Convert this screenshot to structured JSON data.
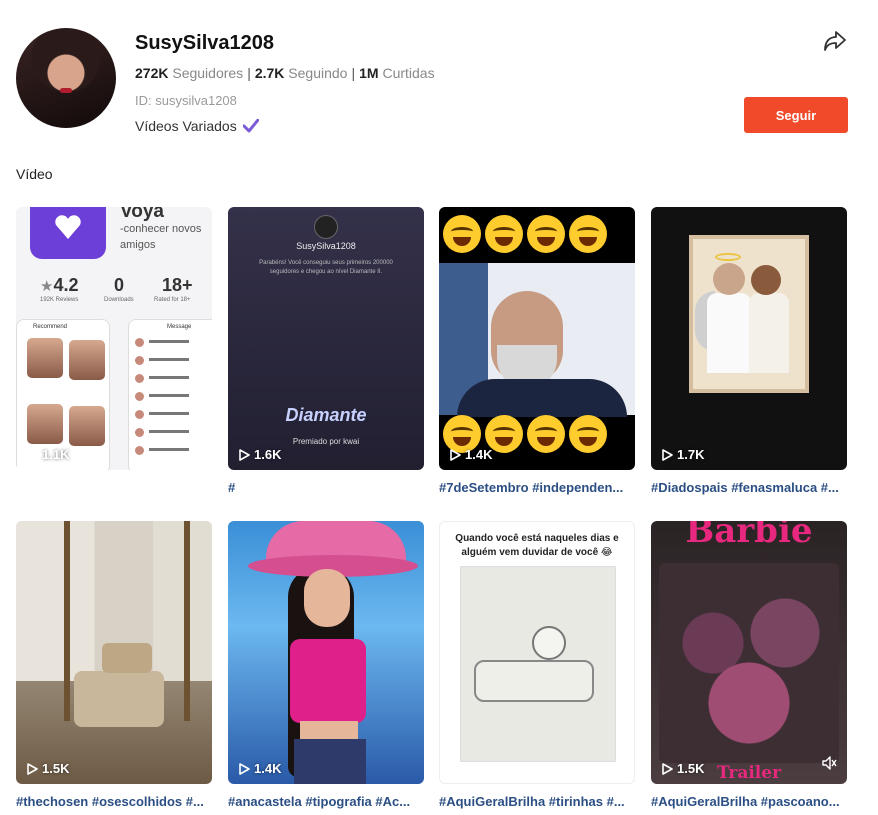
{
  "profile": {
    "name": "SusySilva1208",
    "followers_count": "272K",
    "followers_label": "Seguidores",
    "following_count": "2.7K",
    "following_label": "Seguindo",
    "likes_count": "1M",
    "likes_label": "Curtidas",
    "user_id": "ID: susysilva1208",
    "bio": "Vídeos Variados",
    "follow_label": "Seguir"
  },
  "colors": {
    "follow_button": "#f04a2a",
    "caption": "#2b4f84",
    "verified": "#7b5cd6"
  },
  "section_title": "Vídeo",
  "videos": [
    {
      "views": "1.1K",
      "caption": "",
      "thumb": {
        "title": "Voya",
        "subtitle": "-conhecer novos amigos",
        "rating": "4.2",
        "rating_label": "192K Reviews",
        "downloads": "0",
        "downloads_label": "Downloads",
        "age": "18+",
        "age_label": "Rated for 18+",
        "tab_recommend": "Recommend",
        "tab_message": "Message",
        "chat_names": [
          "TRA MU",
          "Tuyet",
          "AIJU",
          "Linda",
          "JUN",
          "Leah",
          "Li K"
        ]
      }
    },
    {
      "views": "1.6K",
      "caption": "#",
      "thumb": {
        "name": "SusySilva1208",
        "message": "Parabéns! Você conseguiu seus primeiros 200000 seguidores e chegou ao nível Diamante II.",
        "badge": "Diamante",
        "credit": "Premiado por",
        "brand": "kwai"
      }
    },
    {
      "views": "1.4K",
      "caption": "#7deSetembro #independen..."
    },
    {
      "views": "1.7K",
      "caption": "#Diadospais #fenasmaluca #..."
    },
    {
      "views": "1.5K",
      "caption": "#thechosen #osescolhidos #..."
    },
    {
      "views": "1.4K",
      "caption": "#anacastela #tipografia #Ac..."
    },
    {
      "views": "",
      "caption": "#AquiGeralBrilha #tirinhas #...",
      "thumb": {
        "text": "Quando você está naqueles dias e alguém vem duvidar de você 😂"
      }
    },
    {
      "views": "1.5K",
      "caption": "#AquiGeralBrilha #pascoano...",
      "thumb": {
        "title": "Barbie",
        "subtitle": "Trailer"
      }
    }
  ],
  "icons": {
    "share": "share-arrow-icon",
    "verified": "checkmark-icon",
    "views": "play-icon",
    "mute": "muted-speaker-icon"
  }
}
